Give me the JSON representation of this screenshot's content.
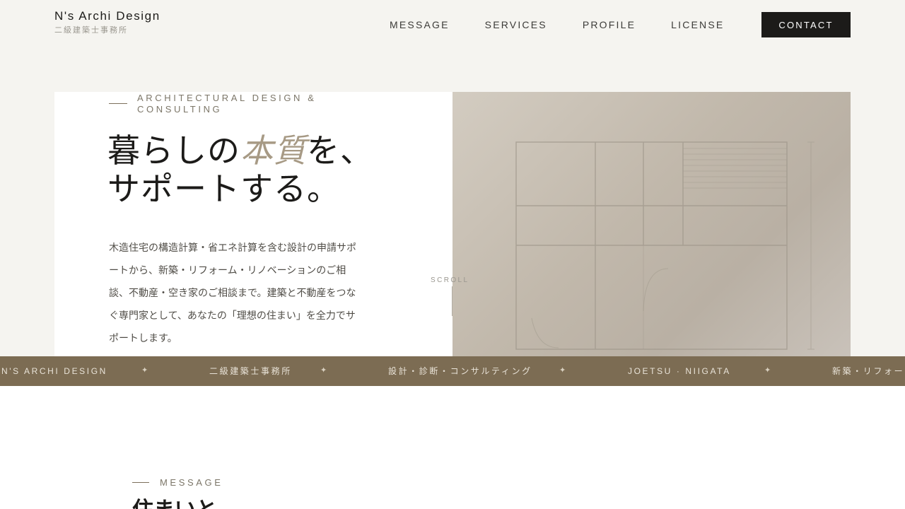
{
  "header": {
    "brand_name": "N's Archi Design",
    "brand_sub": "二級建築士事務所",
    "nav": [
      "MESSAGE",
      "SERVICES",
      "PROFILE",
      "LICENSE"
    ],
    "contact_label": "CONTACT"
  },
  "hero": {
    "eyebrow": "ARCHITECTURAL DESIGN & CONSULTING",
    "headline_line1_pre": "暮らしの",
    "headline_line1_accent": "本質",
    "headline_line1_post": "を、",
    "headline_line2": "サポートする。",
    "lead": "木造住宅の構造計算・省エネ計算を含む設計の申請サポートから、新築・リフォーム・リノベーションのご相談、不動産・空き家のご相談まで。建築と不動産をつなぐ専門家として、あなたの「理想の住まい」を全力でサポートします。",
    "scroll_label": "SCROLL"
  },
  "marquee": {
    "items": [
      "N'S ARCHI DESIGN",
      "二級建築士事務所",
      "設計・診断・コンサルティング",
      "JOETSU · NIIGATA",
      "新築・リフォー"
    ],
    "separator": "✦"
  },
  "message_section": {
    "eyebrow": "MESSAGE",
    "heading": "住まいと"
  },
  "colors": {
    "background": "#f5f4f0",
    "ink": "#1c1b19",
    "accent": "#a79a85",
    "marquee_bg": "#7c6c53",
    "contact_bg": "#1c1b19"
  }
}
